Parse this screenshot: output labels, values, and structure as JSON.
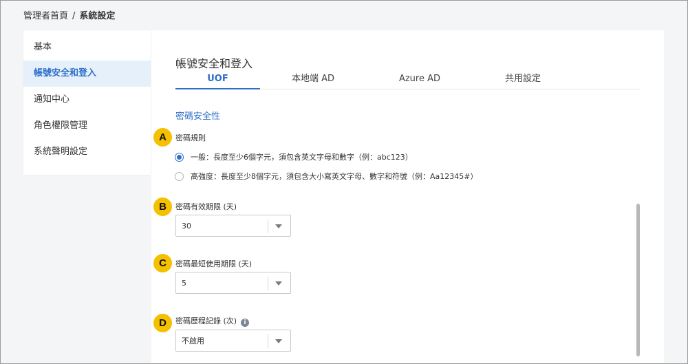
{
  "breadcrumb": {
    "home": "管理者首頁",
    "separator": "/",
    "current": "系統設定"
  },
  "sidebar": {
    "items": [
      {
        "label": "基本"
      },
      {
        "label": "帳號安全和登入"
      },
      {
        "label": "通知中心"
      },
      {
        "label": "角色權限管理"
      },
      {
        "label": "系統聲明設定"
      }
    ]
  },
  "main": {
    "title": "帳號安全和登入",
    "tabs": [
      {
        "label": "UOF"
      },
      {
        "label": "本地端 AD"
      },
      {
        "label": "Azure AD"
      },
      {
        "label": "共用設定"
      }
    ],
    "section_title": "密碼安全性",
    "password_rule": {
      "label": "密碼規則",
      "options": [
        {
          "label": "一般：長度至少6個字元，須包含英文字母和數字（例：abc123）"
        },
        {
          "label": "高強度：長度至少8個字元，須包含大小寫英文字母、數字和符號（例：Aa12345#）"
        }
      ]
    },
    "password_expiry": {
      "label": "密碼有效期限 (天)",
      "value": "30"
    },
    "password_min_age": {
      "label": "密碼最短使用期限 (天)",
      "value": "5"
    },
    "password_history": {
      "label": "密碼歷程記錄 (次)",
      "value": "不啟用",
      "info_glyph": "i"
    }
  },
  "annotations": {
    "a": "A",
    "b": "B",
    "c": "C",
    "d": "D"
  },
  "colors": {
    "accent": "#2f6fc9",
    "badge": "#f5c000",
    "active_bg": "#e6f0fb"
  }
}
